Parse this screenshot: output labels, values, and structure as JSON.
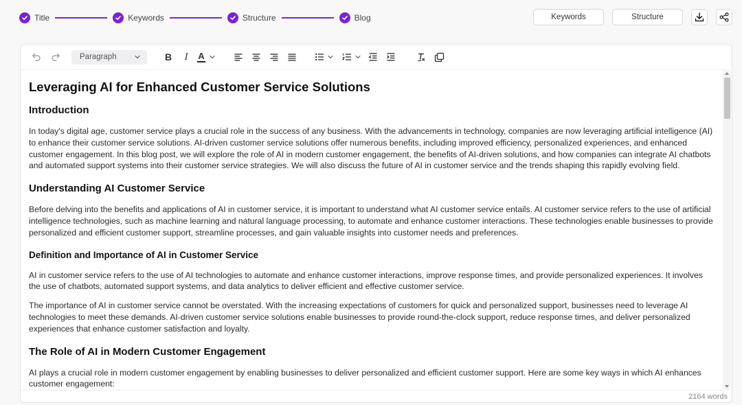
{
  "stepper": {
    "steps": [
      {
        "label": "Title"
      },
      {
        "label": "Keywords"
      },
      {
        "label": "Structure"
      },
      {
        "label": "Blog"
      }
    ]
  },
  "actions": {
    "keywords_label": "Keywords",
    "structure_label": "Structure"
  },
  "toolbar": {
    "block_format": "Paragraph",
    "bold": "B",
    "italic": "I",
    "text_color": "A"
  },
  "document": {
    "title": "Leveraging AI for Enhanced Customer Service Solutions",
    "intro_heading": "Introduction",
    "intro_p": "In today's digital age, customer service plays a crucial role in the success of any business. With the advancements in technology, companies are now leveraging artificial intelligence (AI) to enhance their customer service solutions. AI-driven customer service solutions offer numerous benefits, including improved efficiency, personalized experiences, and enhanced customer engagement. In this blog post, we will explore the role of AI in modern customer engagement, the benefits of AI-driven solutions, and how companies can integrate AI chatbots and automated support systems into their customer service strategies. We will also discuss the future of AI in customer service and the trends shaping this rapidly evolving field.",
    "understanding_heading": "Understanding AI Customer Service",
    "understanding_p": "Before delving into the benefits and applications of AI in customer service, it is important to understand what AI customer service entails. AI customer service refers to the use of artificial intelligence technologies, such as machine learning and natural language processing, to automate and enhance customer interactions. These technologies enable businesses to provide personalized and efficient customer support, streamline processes, and gain valuable insights into customer needs and preferences.",
    "definition_heading": "Definition and Importance of AI in Customer Service",
    "definition_p1": "AI in customer service refers to the use of AI technologies to automate and enhance customer interactions, improve response times, and provide personalized experiences. It involves the use of chatbots, automated support systems, and data analytics to deliver efficient and effective customer service.",
    "definition_p2": "The importance of AI in customer service cannot be overstated. With the increasing expectations of customers for quick and personalized support, businesses need to leverage AI technologies to meet these demands. AI-driven customer service solutions enable businesses to provide round-the-clock support, reduce response times, and deliver personalized experiences that enhance customer satisfaction and loyalty.",
    "role_heading": "The Role of AI in Modern Customer Engagement",
    "role_p": "AI plays a crucial role in modern customer engagement by enabling businesses to deliver personalized and efficient customer support. Here are some key ways in which AI enhances customer engagement:"
  },
  "status": {
    "word_count": "2164 words"
  },
  "colors": {
    "accent": "#7a22d4"
  }
}
